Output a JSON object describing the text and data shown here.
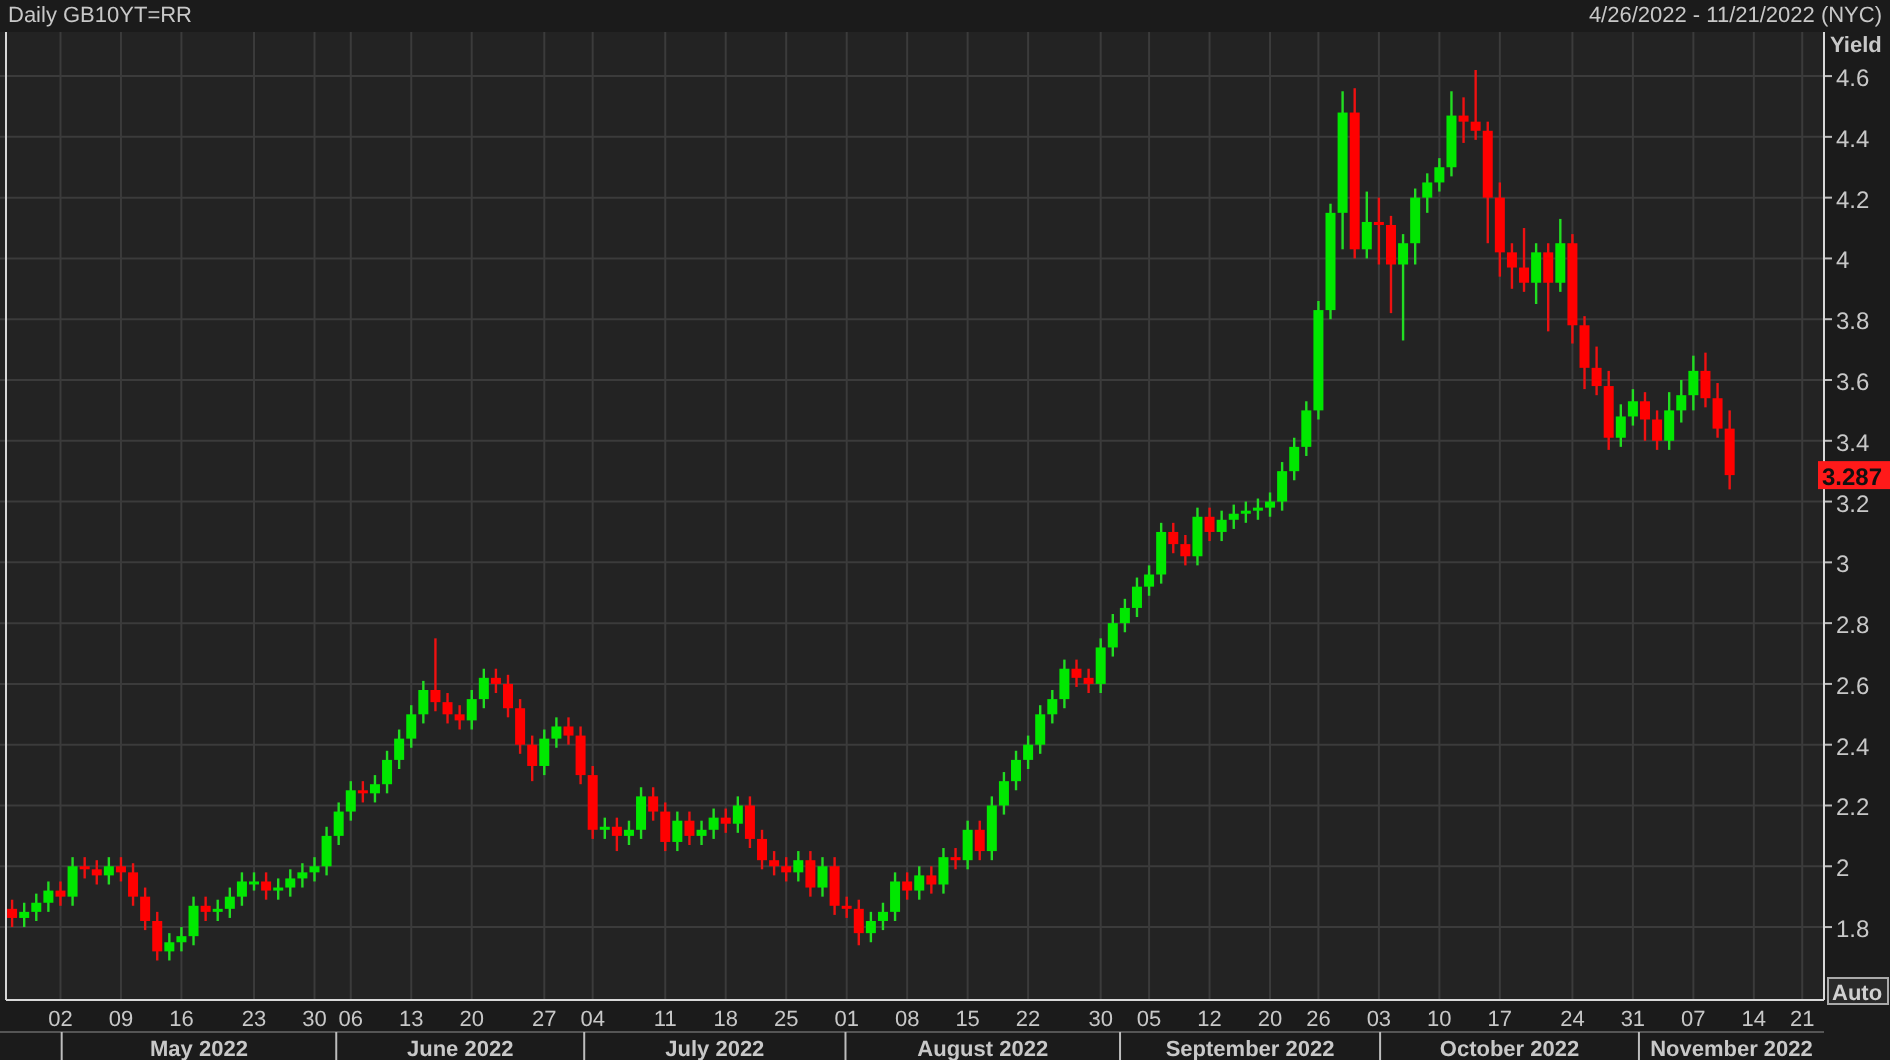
{
  "header": {
    "title": "Daily GB10YT=RR",
    "date_range": "4/26/2022 - 11/21/2022 (NYC)"
  },
  "chart": {
    "y_axis_title": "Yield",
    "last_price": "3.287",
    "auto_button": "Auto",
    "months": [
      "May 2022",
      "June 2022",
      "July 2022",
      "August 2022",
      "September 2022",
      "October 2022",
      "November 2022"
    ],
    "chart_data": {
      "type": "candlestick",
      "grid": true,
      "ylim": [
        1.56,
        4.745
      ],
      "categories": [
        null,
        null,
        null,
        null,
        "02",
        null,
        null,
        null,
        null,
        "09",
        null,
        null,
        null,
        null,
        "16",
        null,
        null,
        null,
        null,
        null,
        "23",
        null,
        null,
        null,
        null,
        "30",
        null,
        null,
        "06",
        null,
        null,
        null,
        null,
        "13",
        null,
        null,
        null,
        null,
        "20",
        null,
        null,
        null,
        null,
        null,
        "27",
        null,
        null,
        null,
        "04",
        null,
        null,
        null,
        null,
        null,
        "11",
        null,
        null,
        null,
        null,
        "18",
        null,
        null,
        null,
        null,
        "25",
        null,
        null,
        null,
        null,
        "01",
        null,
        null,
        null,
        null,
        "08",
        null,
        null,
        null,
        null,
        "15",
        null,
        null,
        null,
        null,
        "22",
        null,
        null,
        null,
        null,
        null,
        "30",
        null,
        null,
        null,
        "05",
        null,
        null,
        null,
        null,
        "12",
        null,
        null,
        null,
        null,
        "20",
        null,
        null,
        null,
        "26",
        null,
        null,
        null,
        null,
        "03",
        null,
        null,
        null,
        null,
        "10",
        null,
        null,
        null,
        null,
        "17",
        null,
        null,
        null,
        null,
        null,
        "24",
        null,
        null,
        null,
        null,
        "31",
        null,
        null,
        null,
        null,
        "07",
        null,
        null,
        null,
        null,
        "14",
        null,
        null,
        null,
        "21",
        null
      ],
      "yticks": [
        4.6,
        4.4,
        4.2,
        4,
        3.8,
        3.6,
        3.4,
        3.2,
        3,
        2.8,
        2.6,
        2.4,
        2.2,
        2,
        1.8
      ],
      "ohlc": [
        [
          1.86,
          1.89,
          1.8,
          1.83
        ],
        [
          1.83,
          1.88,
          1.8,
          1.85
        ],
        [
          1.85,
          1.91,
          1.82,
          1.88
        ],
        [
          1.88,
          1.95,
          1.85,
          1.92
        ],
        [
          1.92,
          1.95,
          1.87,
          1.9
        ],
        [
          1.9,
          2.03,
          1.87,
          2.0
        ],
        [
          2.0,
          2.03,
          1.96,
          1.99
        ],
        [
          1.99,
          2.02,
          1.94,
          1.97
        ],
        [
          1.97,
          2.03,
          1.94,
          2.0
        ],
        [
          2.0,
          2.03,
          1.95,
          1.98
        ],
        [
          1.98,
          2.01,
          1.87,
          1.9
        ],
        [
          1.9,
          1.93,
          1.79,
          1.82
        ],
        [
          1.82,
          1.85,
          1.69,
          1.72
        ],
        [
          1.72,
          1.78,
          1.69,
          1.75
        ],
        [
          1.75,
          1.8,
          1.72,
          1.77
        ],
        [
          1.77,
          1.9,
          1.74,
          1.87
        ],
        [
          1.87,
          1.9,
          1.82,
          1.85
        ],
        [
          1.85,
          1.89,
          1.82,
          1.86
        ],
        [
          1.86,
          1.93,
          1.83,
          1.9
        ],
        [
          1.9,
          1.98,
          1.87,
          1.95
        ],
        [
          1.95,
          1.98,
          1.92,
          1.95
        ],
        [
          1.95,
          1.98,
          1.89,
          1.92
        ],
        [
          1.92,
          1.96,
          1.89,
          1.93
        ],
        [
          1.93,
          1.99,
          1.9,
          1.96
        ],
        [
          1.96,
          2.01,
          1.93,
          1.98
        ],
        [
          1.98,
          2.03,
          1.95,
          2.0
        ],
        [
          2.0,
          2.13,
          1.97,
          2.1
        ],
        [
          2.1,
          2.21,
          2.07,
          2.18
        ],
        [
          2.18,
          2.28,
          2.15,
          2.25
        ],
        [
          2.25,
          2.28,
          2.21,
          2.24
        ],
        [
          2.24,
          2.3,
          2.21,
          2.27
        ],
        [
          2.27,
          2.38,
          2.24,
          2.35
        ],
        [
          2.35,
          2.45,
          2.32,
          2.42
        ],
        [
          2.42,
          2.53,
          2.39,
          2.5
        ],
        [
          2.5,
          2.61,
          2.47,
          2.58
        ],
        [
          2.58,
          2.75,
          2.51,
          2.54
        ],
        [
          2.54,
          2.57,
          2.47,
          2.5
        ],
        [
          2.5,
          2.53,
          2.45,
          2.48
        ],
        [
          2.48,
          2.58,
          2.45,
          2.55
        ],
        [
          2.55,
          2.65,
          2.52,
          2.62
        ],
        [
          2.62,
          2.65,
          2.57,
          2.6
        ],
        [
          2.6,
          2.63,
          2.49,
          2.52
        ],
        [
          2.52,
          2.55,
          2.37,
          2.4
        ],
        [
          2.4,
          2.43,
          2.28,
          2.33
        ],
        [
          2.33,
          2.45,
          2.3,
          2.42
        ],
        [
          2.42,
          2.49,
          2.39,
          2.46
        ],
        [
          2.46,
          2.49,
          2.4,
          2.43
        ],
        [
          2.43,
          2.46,
          2.27,
          2.3
        ],
        [
          2.3,
          2.33,
          2.09,
          2.12
        ],
        [
          2.12,
          2.16,
          2.09,
          2.13
        ],
        [
          2.13,
          2.16,
          2.05,
          2.1
        ],
        [
          2.1,
          2.15,
          2.07,
          2.12
        ],
        [
          2.12,
          2.26,
          2.09,
          2.23
        ],
        [
          2.23,
          2.26,
          2.15,
          2.18
        ],
        [
          2.18,
          2.21,
          2.05,
          2.08
        ],
        [
          2.08,
          2.18,
          2.05,
          2.15
        ],
        [
          2.15,
          2.18,
          2.07,
          2.1
        ],
        [
          2.1,
          2.15,
          2.07,
          2.12
        ],
        [
          2.12,
          2.19,
          2.09,
          2.16
        ],
        [
          2.16,
          2.19,
          2.11,
          2.14
        ],
        [
          2.14,
          2.23,
          2.11,
          2.2
        ],
        [
          2.2,
          2.23,
          2.06,
          2.09
        ],
        [
          2.09,
          2.12,
          1.99,
          2.02
        ],
        [
          2.02,
          2.05,
          1.97,
          2.0
        ],
        [
          2.0,
          2.03,
          1.95,
          1.98
        ],
        [
          1.98,
          2.05,
          1.95,
          2.02
        ],
        [
          2.02,
          2.05,
          1.9,
          1.93
        ],
        [
          1.93,
          2.03,
          1.9,
          2.0
        ],
        [
          2.0,
          2.03,
          1.84,
          1.87
        ],
        [
          1.87,
          1.9,
          1.83,
          1.86
        ],
        [
          1.86,
          1.89,
          1.74,
          1.78
        ],
        [
          1.78,
          1.85,
          1.75,
          1.82
        ],
        [
          1.82,
          1.88,
          1.79,
          1.85
        ],
        [
          1.85,
          1.98,
          1.82,
          1.95
        ],
        [
          1.95,
          1.98,
          1.89,
          1.92
        ],
        [
          1.92,
          2.0,
          1.89,
          1.97
        ],
        [
          1.97,
          2.0,
          1.91,
          1.94
        ],
        [
          1.94,
          2.06,
          1.91,
          2.03
        ],
        [
          2.03,
          2.06,
          1.99,
          2.02
        ],
        [
          2.02,
          2.15,
          1.99,
          2.12
        ],
        [
          2.12,
          2.15,
          2.02,
          2.05
        ],
        [
          2.05,
          2.23,
          2.02,
          2.2
        ],
        [
          2.2,
          2.31,
          2.17,
          2.28
        ],
        [
          2.28,
          2.38,
          2.25,
          2.35
        ],
        [
          2.35,
          2.43,
          2.32,
          2.4
        ],
        [
          2.4,
          2.53,
          2.37,
          2.5
        ],
        [
          2.5,
          2.58,
          2.47,
          2.55
        ],
        [
          2.55,
          2.68,
          2.52,
          2.65
        ],
        [
          2.65,
          2.68,
          2.59,
          2.62
        ],
        [
          2.62,
          2.65,
          2.57,
          2.6
        ],
        [
          2.6,
          2.75,
          2.57,
          2.72
        ],
        [
          2.72,
          2.83,
          2.69,
          2.8
        ],
        [
          2.8,
          2.88,
          2.77,
          2.85
        ],
        [
          2.85,
          2.95,
          2.82,
          2.92
        ],
        [
          2.92,
          2.99,
          2.89,
          2.96
        ],
        [
          2.96,
          3.13,
          2.93,
          3.1
        ],
        [
          3.1,
          3.13,
          3.03,
          3.06
        ],
        [
          3.06,
          3.09,
          2.99,
          3.02
        ],
        [
          3.02,
          3.18,
          2.99,
          3.15
        ],
        [
          3.15,
          3.18,
          3.07,
          3.1
        ],
        [
          3.1,
          3.17,
          3.07,
          3.14
        ],
        [
          3.14,
          3.19,
          3.11,
          3.16
        ],
        [
          3.16,
          3.2,
          3.13,
          3.17
        ],
        [
          3.17,
          3.21,
          3.14,
          3.18
        ],
        [
          3.18,
          3.23,
          3.15,
          3.2
        ],
        [
          3.2,
          3.33,
          3.17,
          3.3
        ],
        [
          3.3,
          3.41,
          3.27,
          3.38
        ],
        [
          3.38,
          3.53,
          3.35,
          3.5
        ],
        [
          3.5,
          3.86,
          3.47,
          3.83
        ],
        [
          3.83,
          4.18,
          3.8,
          4.15
        ],
        [
          4.15,
          4.55,
          4.03,
          4.48
        ],
        [
          4.48,
          4.56,
          4.0,
          4.03
        ],
        [
          4.03,
          4.22,
          4.0,
          4.12
        ],
        [
          4.12,
          4.2,
          3.98,
          4.11
        ],
        [
          4.11,
          4.14,
          3.82,
          3.98
        ],
        [
          3.98,
          4.08,
          3.73,
          4.05
        ],
        [
          4.05,
          4.23,
          3.98,
          4.2
        ],
        [
          4.2,
          4.28,
          4.15,
          4.25
        ],
        [
          4.25,
          4.33,
          4.22,
          4.3
        ],
        [
          4.3,
          4.55,
          4.27,
          4.47
        ],
        [
          4.47,
          4.53,
          4.38,
          4.45
        ],
        [
          4.45,
          4.62,
          4.39,
          4.42
        ],
        [
          4.42,
          4.45,
          4.05,
          4.2
        ],
        [
          4.2,
          4.25,
          3.94,
          4.02
        ],
        [
          4.02,
          4.05,
          3.9,
          3.97
        ],
        [
          3.97,
          4.1,
          3.89,
          3.92
        ],
        [
          3.92,
          4.05,
          3.85,
          4.02
        ],
        [
          4.02,
          4.05,
          3.76,
          3.92
        ],
        [
          3.92,
          4.13,
          3.89,
          4.05
        ],
        [
          4.05,
          4.08,
          3.72,
          3.78
        ],
        [
          3.78,
          3.81,
          3.57,
          3.64
        ],
        [
          3.64,
          3.71,
          3.55,
          3.58
        ],
        [
          3.58,
          3.63,
          3.37,
          3.41
        ],
        [
          3.41,
          3.52,
          3.38,
          3.48
        ],
        [
          3.48,
          3.57,
          3.45,
          3.53
        ],
        [
          3.53,
          3.56,
          3.4,
          3.47
        ],
        [
          3.47,
          3.5,
          3.37,
          3.4
        ],
        [
          3.4,
          3.56,
          3.37,
          3.5
        ],
        [
          3.5,
          3.6,
          3.46,
          3.55
        ],
        [
          3.55,
          3.68,
          3.5,
          3.63
        ],
        [
          3.63,
          3.69,
          3.51,
          3.54
        ],
        [
          3.54,
          3.59,
          3.41,
          3.44
        ],
        [
          3.44,
          3.5,
          3.24,
          3.287
        ],
        null,
        null,
        null,
        null,
        null,
        null,
        null
      ]
    }
  }
}
